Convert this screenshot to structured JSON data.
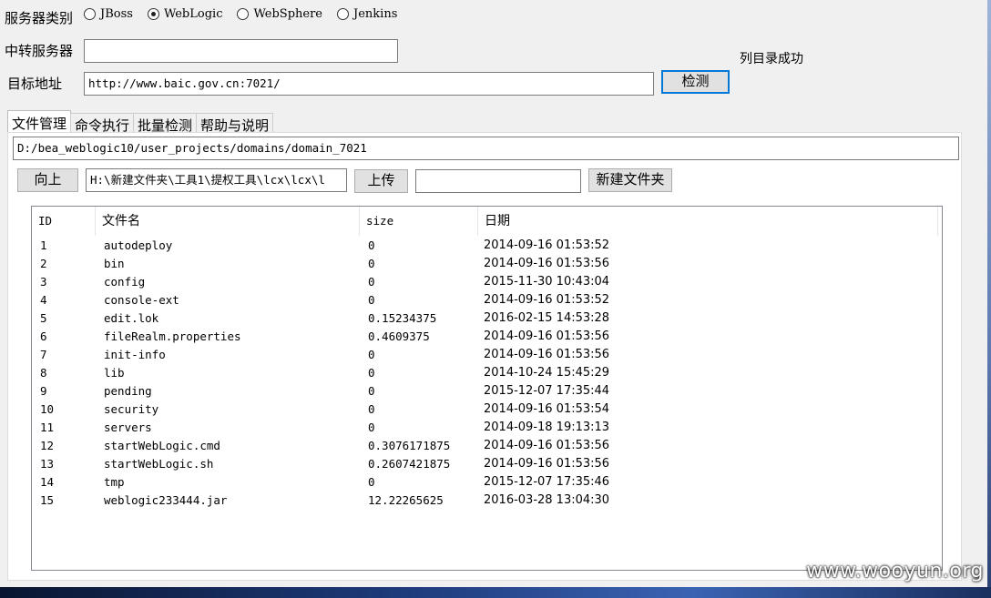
{
  "form": {
    "server_type_label": "服务器类别",
    "server_types": [
      {
        "label": "JBoss",
        "checked": false
      },
      {
        "label": "WebLogic",
        "checked": true
      },
      {
        "label": "WebSphere",
        "checked": false
      },
      {
        "label": "Jenkins",
        "checked": false
      }
    ],
    "relay_label": "中转服务器",
    "relay_value": "",
    "target_label": "目标地址",
    "target_value": "http://www.baic.gov.cn:7021/",
    "check_button": "检测",
    "status_text": "列目录成功"
  },
  "tabs": [
    {
      "label": "文件管理",
      "active": true
    },
    {
      "label": "命令执行",
      "active": false
    },
    {
      "label": "批量检测",
      "active": false
    },
    {
      "label": "帮助与说明",
      "active": false
    }
  ],
  "file_manager": {
    "path_value": "D:/bea_weblogic10/user_projects/domains/domain_7021",
    "up_button": "向上",
    "local_path_value": "H:\\新建文件夹\\工具1\\提权工具\\lcx\\lcx\\l",
    "upload_button": "上传",
    "folder_name_value": "",
    "new_folder_button": "新建文件夹",
    "columns": [
      "ID",
      "文件名",
      "size",
      "日期"
    ],
    "rows": [
      {
        "id": "1",
        "name": "autodeploy",
        "size": "0",
        "date": "2014-09-16 01:53:52"
      },
      {
        "id": "2",
        "name": "bin",
        "size": "0",
        "date": "2014-09-16 01:53:56"
      },
      {
        "id": "3",
        "name": "config",
        "size": "0",
        "date": "2015-11-30 10:43:04"
      },
      {
        "id": "4",
        "name": "console-ext",
        "size": "0",
        "date": "2014-09-16 01:53:52"
      },
      {
        "id": "5",
        "name": "edit.lok",
        "size": "0.15234375",
        "date": "2016-02-15 14:53:28"
      },
      {
        "id": "6",
        "name": "fileRealm.properties",
        "size": "0.4609375",
        "date": "2014-09-16 01:53:56"
      },
      {
        "id": "7",
        "name": "init-info",
        "size": "0",
        "date": "2014-09-16 01:53:56"
      },
      {
        "id": "8",
        "name": "lib",
        "size": "0",
        "date": "2014-10-24 15:45:29"
      },
      {
        "id": "9",
        "name": "pending",
        "size": "0",
        "date": "2015-12-07 17:35:44"
      },
      {
        "id": "10",
        "name": "security",
        "size": "0",
        "date": "2014-09-16 01:53:54"
      },
      {
        "id": "11",
        "name": "servers",
        "size": "0",
        "date": "2014-09-18 19:13:13"
      },
      {
        "id": "12",
        "name": "startWebLogic.cmd",
        "size": "0.3076171875",
        "date": "2014-09-16 01:53:56"
      },
      {
        "id": "13",
        "name": "startWebLogic.sh",
        "size": "0.2607421875",
        "date": "2014-09-16 01:53:56"
      },
      {
        "id": "14",
        "name": "tmp",
        "size": "0",
        "date": "2015-12-07 17:35:46"
      },
      {
        "id": "15",
        "name": "weblogic233444.jar",
        "size": "12.22265625",
        "date": "2016-03-28 13:04:30"
      }
    ]
  },
  "watermark": "www.wooyun.org"
}
